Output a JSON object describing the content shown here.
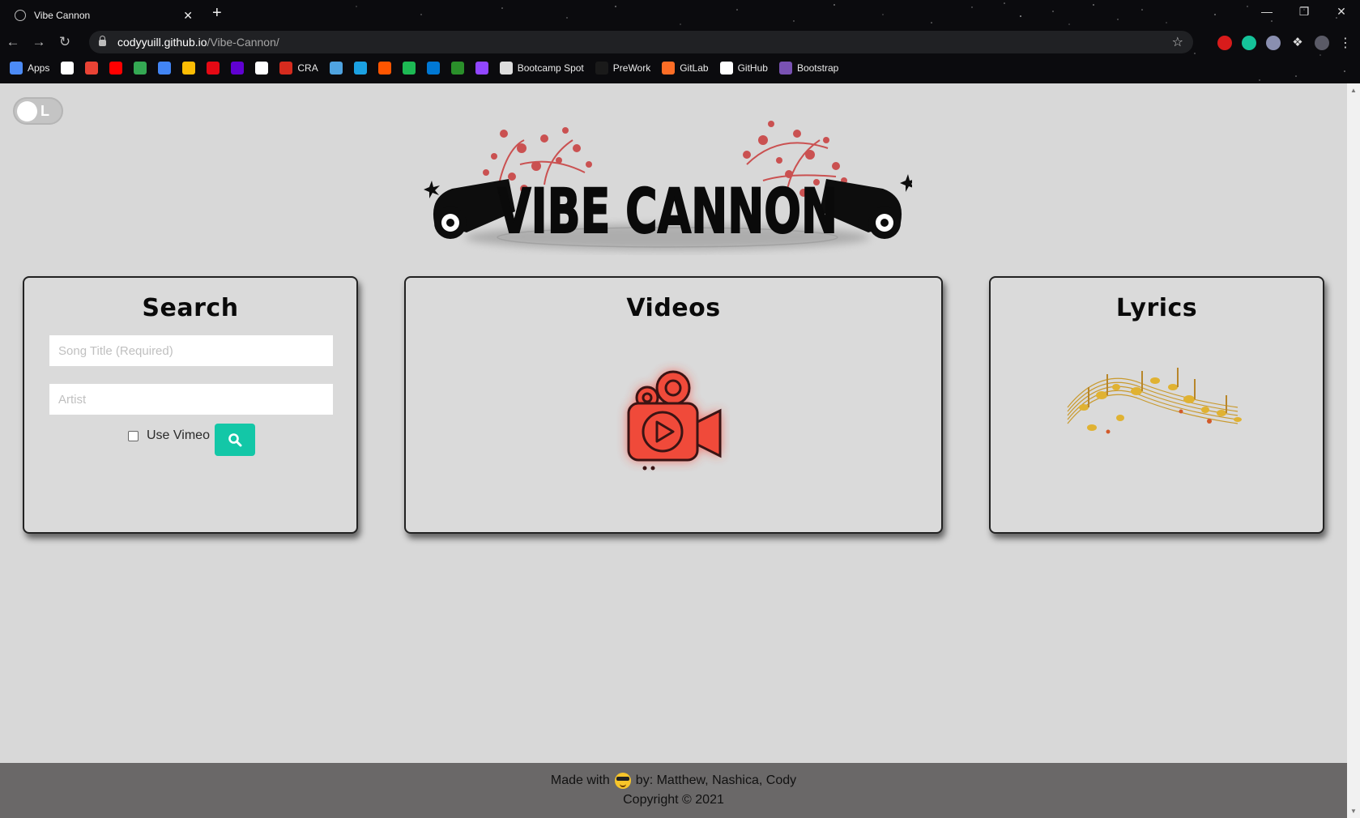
{
  "browser": {
    "tab_title": "Vibe Cannon",
    "close_tab": "✕",
    "new_tab": "+",
    "url_host": "codyyuill.github.io",
    "url_path": "/Vibe-Cannon/",
    "bookmarks": [
      {
        "label": "Apps",
        "icon": "apps-grid-icon",
        "color": "#4c8bf5"
      },
      {
        "label": "",
        "icon": "calendar-icon",
        "color": "#ffffff"
      },
      {
        "label": "",
        "icon": "gmail-icon",
        "color": "#ea4335"
      },
      {
        "label": "",
        "icon": "youtube-icon",
        "color": "#ff0000"
      },
      {
        "label": "",
        "icon": "maps-icon",
        "color": "#34a853"
      },
      {
        "label": "",
        "icon": "translate-icon",
        "color": "#4285f4"
      },
      {
        "label": "",
        "icon": "drive-icon",
        "color": "#fbbc04"
      },
      {
        "label": "",
        "icon": "netflix-icon",
        "color": "#e50914"
      },
      {
        "label": "",
        "icon": "yahoo-icon",
        "color": "#6001d2"
      },
      {
        "label": "",
        "icon": "amazon-icon",
        "color": "#ffffff"
      },
      {
        "label": "CRA",
        "icon": "maple-leaf-icon",
        "color": "#d52b1e"
      },
      {
        "label": "",
        "icon": "cloud-download-icon",
        "color": "#4fa3e0"
      },
      {
        "label": "",
        "icon": "notion-icon",
        "color": "#1ba1e2"
      },
      {
        "label": "",
        "icon": "soundcloud-icon",
        "color": "#ff5500"
      },
      {
        "label": "",
        "icon": "spotify-icon",
        "color": "#1db954"
      },
      {
        "label": "",
        "icon": "webex-icon",
        "color": "#0078d4"
      },
      {
        "label": "",
        "icon": "td-bank-icon",
        "color": "#2a8f2a"
      },
      {
        "label": "",
        "icon": "twitch-icon",
        "color": "#9146ff"
      },
      {
        "label": "Bootcamp Spot",
        "icon": "globe-icon",
        "color": "#dddddd"
      },
      {
        "label": "PreWork",
        "icon": "bookmark-icon",
        "color": "#1a1a1a"
      },
      {
        "label": "GitLab",
        "icon": "gitlab-icon",
        "color": "#fc6d26"
      },
      {
        "label": "GitHub",
        "icon": "github-icon",
        "color": "#ffffff"
      },
      {
        "label": "Bootstrap",
        "icon": "bootstrap-icon",
        "color": "#7952b3"
      }
    ]
  },
  "page": {
    "theme_toggle_label": "L",
    "logo_text": "VIBE CANNON",
    "search": {
      "title": "Search",
      "song_placeholder": "Song Title (Required)",
      "artist_placeholder": "Artist",
      "vimeo_label": "Use Vimeo"
    },
    "videos": {
      "title": "Videos"
    },
    "lyrics": {
      "title": "Lyrics"
    },
    "footer": {
      "made_with": "Made with",
      "by_line": "by: Matthew, Nashica, Cody",
      "copyright": "Copyright © 2021"
    }
  },
  "colors": {
    "page_bg": "#d8d8d8",
    "search_button": "#13c7a7",
    "footer_bg": "#6a6868",
    "camera_red": "#f04a3a"
  }
}
